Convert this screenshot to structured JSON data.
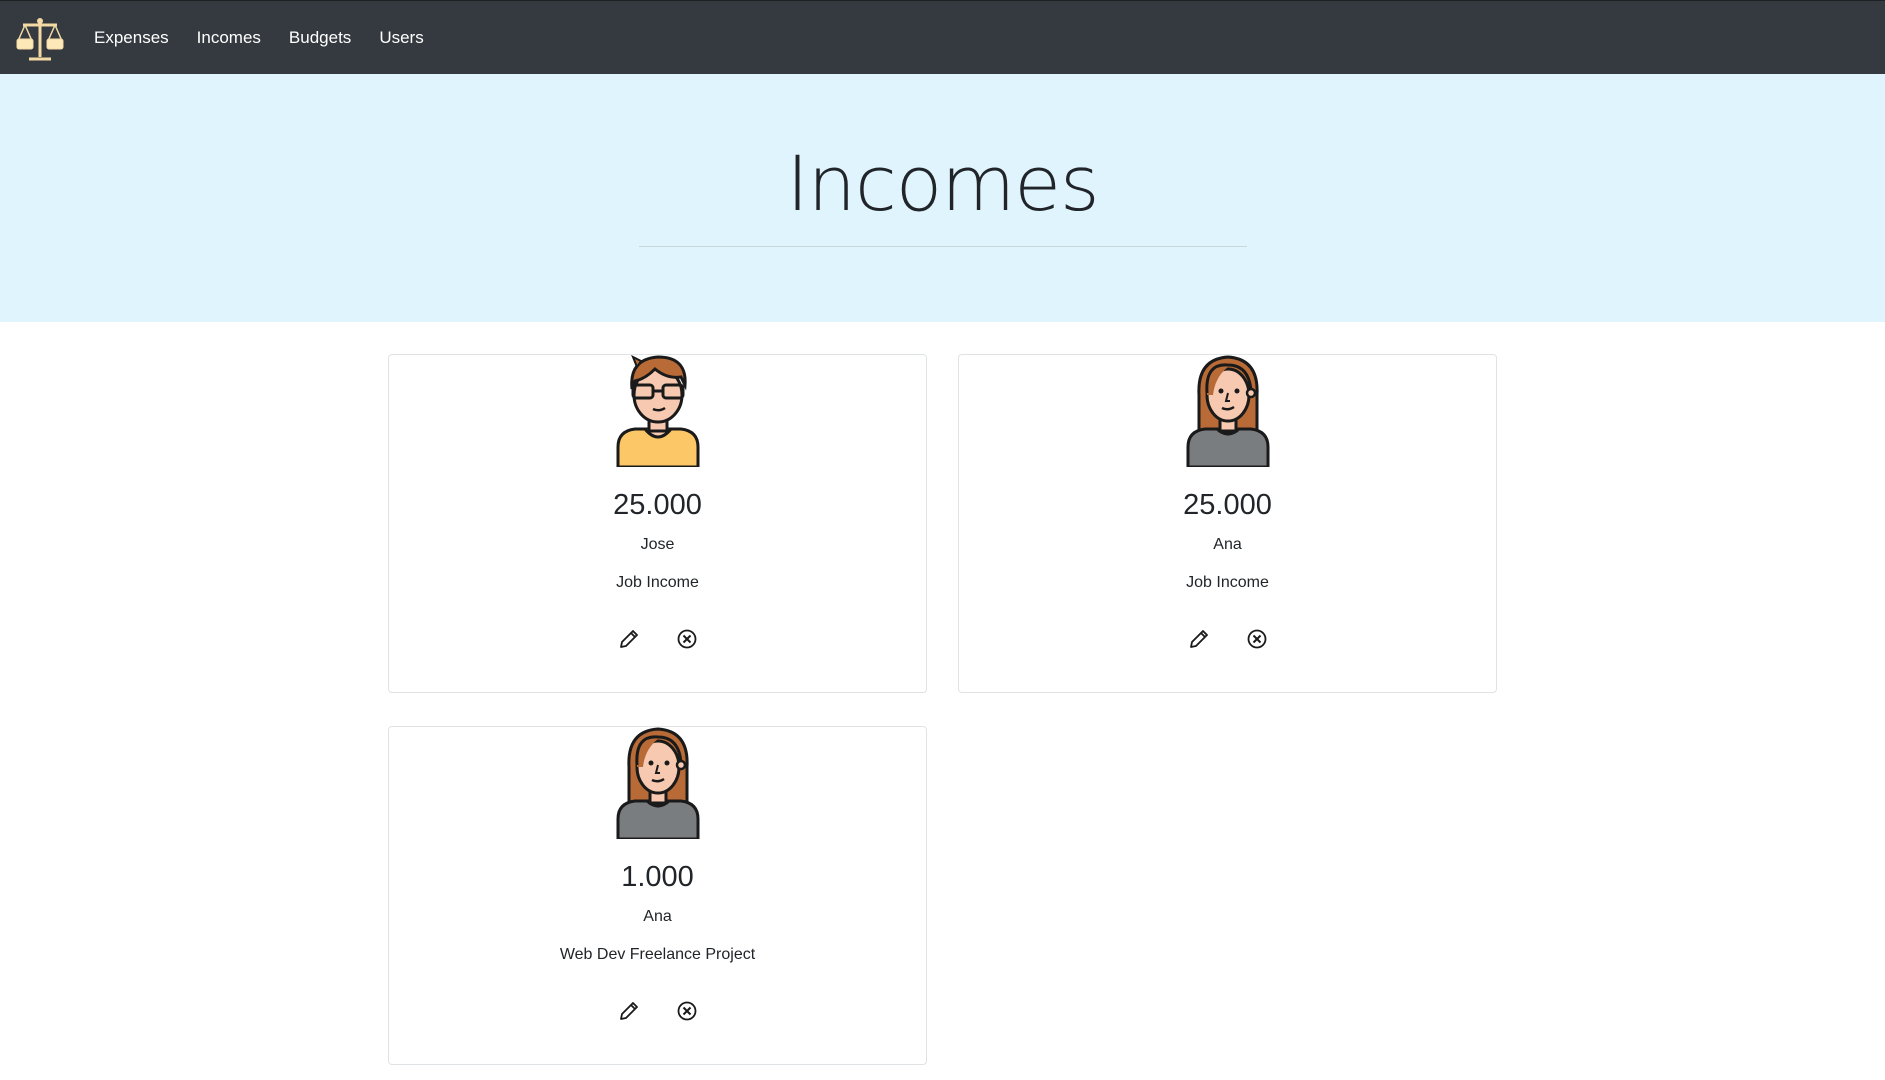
{
  "nav": {
    "items": [
      {
        "label": "Expenses"
      },
      {
        "label": "Incomes"
      },
      {
        "label": "Budgets"
      },
      {
        "label": "Users"
      }
    ],
    "logo_icon": "balance-scale-icon"
  },
  "hero": {
    "title": "Incomes"
  },
  "incomes": [
    {
      "amount": "25.000",
      "user": "Jose",
      "description": "Job Income",
      "avatar": "male-avatar"
    },
    {
      "amount": "25.000",
      "user": "Ana",
      "description": "Job Income",
      "avatar": "female-avatar"
    },
    {
      "amount": "1.000",
      "user": "Ana",
      "description": "Web Dev Freelance Project",
      "avatar": "female-avatar"
    }
  ],
  "colors": {
    "navbar": "#343a40",
    "hero_bg": "#e0f4fe",
    "male_shirt": "#fbc767",
    "female_shirt": "#7a7d80",
    "hair": "#b86b36"
  }
}
